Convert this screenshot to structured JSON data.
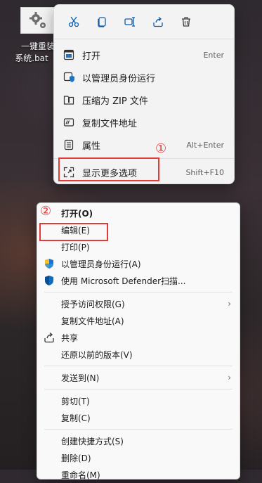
{
  "desktop_icon": {
    "name_line1": "一键重装",
    "name_line2": "系统.bat"
  },
  "modern_menu": {
    "toolbar": [
      "cut-icon",
      "copy-icon",
      "rename-icon",
      "share-icon",
      "delete-icon"
    ],
    "items": [
      {
        "label": "打开",
        "shortcut": "Enter",
        "icon": "open-icon"
      },
      {
        "label": "以管理员身份运行",
        "shortcut": "",
        "icon": "shield-icon"
      },
      {
        "label": "压缩为 ZIP 文件",
        "shortcut": "",
        "icon": "zip-folder-icon"
      },
      {
        "label": "复制文件地址",
        "shortcut": "",
        "icon": "copy-path-icon"
      },
      {
        "label": "属性",
        "shortcut": "Alt+Enter",
        "icon": "properties-icon"
      },
      {
        "label": "显示更多选项",
        "shortcut": "Shift+F10",
        "icon": "more-options-icon"
      }
    ],
    "annotation": "①"
  },
  "classic_menu": {
    "annotation": "②",
    "items": [
      {
        "label": "打开(O)",
        "bold": true
      },
      {
        "label": "编辑(E)"
      },
      {
        "label": "打印(P)"
      },
      {
        "label": "以管理员身份运行(A)",
        "icon": "uac-shield-icon"
      },
      {
        "label": "使用 Microsoft Defender扫描...",
        "icon": "defender-icon"
      },
      {
        "label": "授予访问权限(G)",
        "submenu": true
      },
      {
        "label": "复制文件地址(A)"
      },
      {
        "label": "共享",
        "icon": "share-icon"
      },
      {
        "label": "还原以前的版本(V)"
      },
      {
        "label": "发送到(N)",
        "submenu": true
      },
      {
        "label": "剪切(T)"
      },
      {
        "label": "复制(C)"
      },
      {
        "label": "创建快捷方式(S)"
      },
      {
        "label": "删除(D)"
      },
      {
        "label": "重命名(M)"
      }
    ]
  },
  "colors": {
    "highlight": "#e53935",
    "accent": "#005fb8"
  }
}
